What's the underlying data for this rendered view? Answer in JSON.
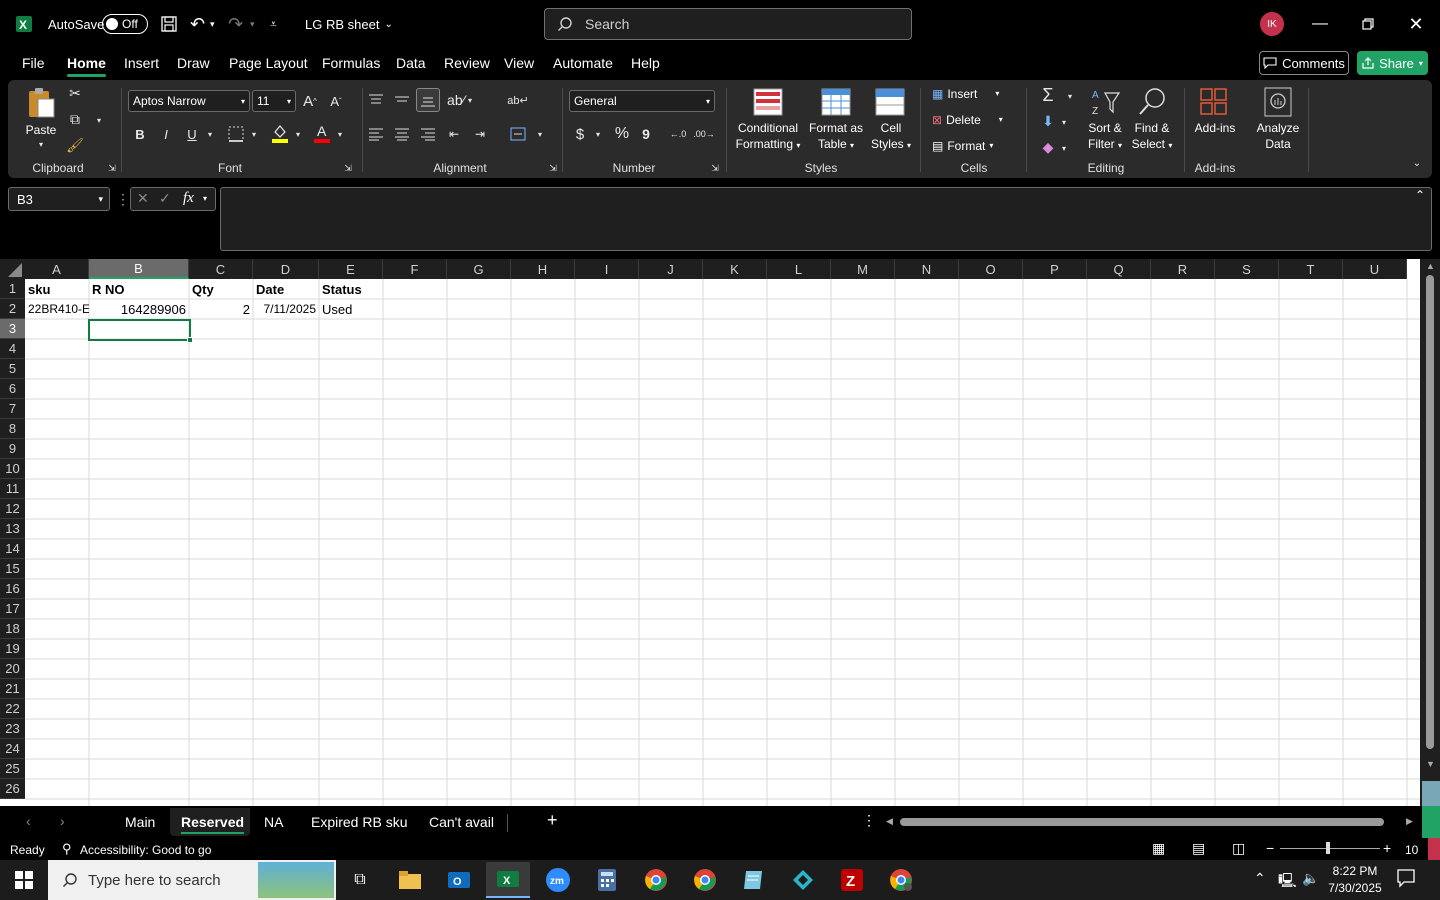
{
  "title_bar": {
    "autosave_label": "AutoSave",
    "autosave_state": "Off",
    "file_name": "LG RB sheet",
    "search_placeholder": "Search",
    "avatar_initials": "IK"
  },
  "menu": {
    "tabs": [
      "File",
      "Home",
      "Insert",
      "Draw",
      "Page Layout",
      "Formulas",
      "Data",
      "Review",
      "View",
      "Automate",
      "Help"
    ],
    "active": "Home",
    "comments_label": "Comments",
    "share_label": "Share"
  },
  "ribbon": {
    "clipboard": {
      "paste": "Paste",
      "label": "Clipboard"
    },
    "font": {
      "name": "Aptos Narrow",
      "size": "11",
      "label": "Font",
      "bold": "B",
      "italic": "I",
      "underline": "U"
    },
    "alignment": {
      "label": "Alignment"
    },
    "number": {
      "format": "General",
      "label": "Number",
      "currency": "$",
      "percent": "%",
      "comma": "9"
    },
    "styles": {
      "conditional_1": "Conditional",
      "conditional_2": "Formatting",
      "format_table_1": "Format as",
      "format_table_2": "Table",
      "cell_styles_1": "Cell",
      "cell_styles_2": "Styles",
      "label": "Styles"
    },
    "cells": {
      "insert": "Insert",
      "delete": "Delete",
      "format": "Format",
      "label": "Cells"
    },
    "editing": {
      "sort_1": "Sort &",
      "sort_2": "Filter",
      "find_1": "Find &",
      "find_2": "Select",
      "label": "Editing"
    },
    "addins": {
      "addins": "Add-ins",
      "analyze_1": "Analyze",
      "analyze_2": "Data",
      "label": "Add-ins"
    },
    "colors": {
      "highlight": "#ffff00",
      "font_color": "#ff0000",
      "accent": "#21a366"
    }
  },
  "formula_bar": {
    "name_box": "B3",
    "fx": "fx",
    "value": ""
  },
  "sheet": {
    "columns": [
      "A",
      "B",
      "C",
      "D",
      "E",
      "F",
      "G",
      "H",
      "I",
      "J",
      "K",
      "L",
      "M",
      "N",
      "O",
      "P",
      "Q",
      "R",
      "S",
      "T",
      "U"
    ],
    "rows": [
      "1",
      "2",
      "3",
      "4",
      "5",
      "6",
      "7",
      "8",
      "9",
      "10",
      "11",
      "12",
      "13",
      "14",
      "15",
      "16",
      "17",
      "18",
      "19",
      "20",
      "21",
      "22",
      "23",
      "24",
      "25",
      "26"
    ],
    "selected_column": "B",
    "selected_row": "3",
    "header_row": {
      "a": "sku",
      "b": "R NO",
      "c": "Qty",
      "d": "Date",
      "e": "Status"
    },
    "data_row": {
      "a": "22BR410-E",
      "b": "164289906",
      "c": "2",
      "d": "7/11/2025",
      "e": "Used"
    }
  },
  "sheet_tabs": {
    "tabs": [
      "Main",
      "Reserved",
      "NA",
      "Expired RB sku",
      "Can't avail"
    ],
    "active": "Reserved",
    "add": "+"
  },
  "status_bar": {
    "ready": "Ready",
    "accessibility": "Accessibility: Good to go",
    "zoom": "10"
  },
  "taskbar": {
    "search_placeholder": "Type here to search",
    "time": "8:22 PM",
    "date": "7/30/2025"
  }
}
